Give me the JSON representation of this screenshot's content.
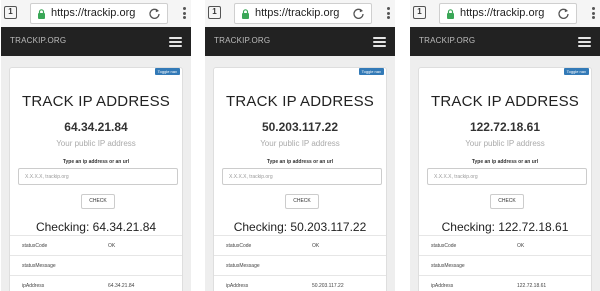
{
  "browser": {
    "tab_count": "1",
    "url": "https://trackip.org"
  },
  "navbar": {
    "brand": "TRACKIP.ORG"
  },
  "card": {
    "toggle_label": "Toggle nav",
    "title": "TRACK IP ADDRESS",
    "subtitle": "Your public IP address",
    "input_label": "Type an ip address or an url",
    "input_placeholder": "X.X.X.X, trackip.org",
    "check_label": "CHECK",
    "row_keys": [
      "statusCode",
      "statusMessage",
      "ipAddress"
    ],
    "status_code": "OK",
    "status_message": ""
  },
  "screens": [
    {
      "ip": "64.34.21.84",
      "checking": "Checking: 64.34.21.84",
      "ip_address": "64.34.21.84"
    },
    {
      "ip": "50.203.117.22",
      "checking": "Checking: 50.203.117.22",
      "ip_address": "50.203.117.22"
    },
    {
      "ip": "122.72.18.61",
      "checking": "Checking: 122.72.18.61",
      "ip_address": "122.72.18.61"
    }
  ],
  "colors": {
    "lock": "#3aa757",
    "navbar": "#222222",
    "toggle": "#337ab7"
  },
  "icons": [
    "tab-switcher-icon",
    "lock-icon",
    "reload-icon",
    "overflow-menu-icon",
    "hamburger-menu-icon"
  ]
}
